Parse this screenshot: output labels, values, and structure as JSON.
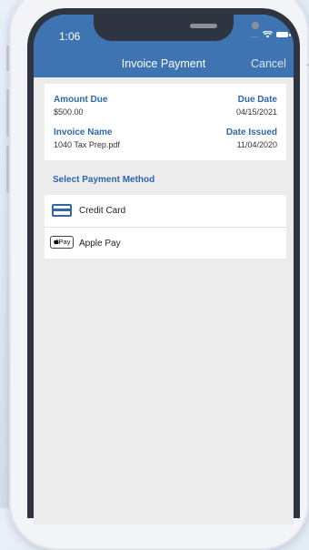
{
  "status_bar": {
    "time": "1:06",
    "dots": "....",
    "wifi_icon": "wifi-icon",
    "battery_icon": "battery-icon"
  },
  "nav": {
    "title": "Invoice Payment",
    "cancel_label": "Cancel"
  },
  "invoice": {
    "amount_due_label": "Amount Due",
    "amount_due_value": "$500.00",
    "due_date_label": "Due Date",
    "due_date_value": "04/15/2021",
    "invoice_name_label": "Invoice Name",
    "invoice_name_value": "1040 Tax Prep.pdf",
    "date_issued_label": "Date Issued",
    "date_issued_value": "11/04/2020"
  },
  "payment": {
    "section_title": "Select Payment Method",
    "methods": [
      {
        "label": "Credit Card",
        "icon": "credit-card-icon"
      },
      {
        "label": "Apple Pay",
        "icon": "apple-pay-icon",
        "icon_text": "Pay"
      }
    ]
  },
  "colors": {
    "header": "#3e74b1",
    "accent": "#2f67a8",
    "screen_bg": "#ececec"
  }
}
